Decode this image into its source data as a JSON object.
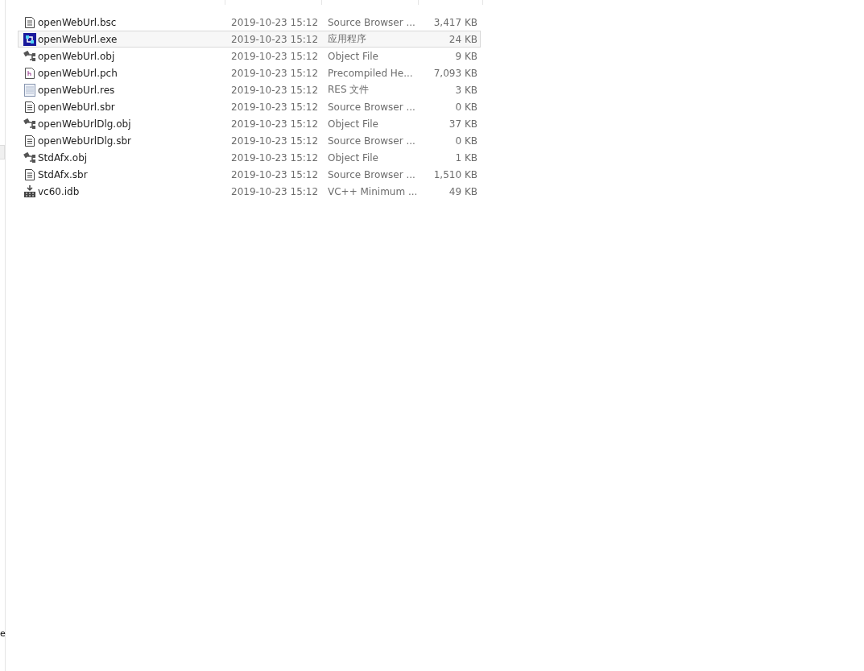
{
  "files": [
    {
      "kind": "document",
      "name": "openWebUrl.bsc",
      "date": "2019-10-23 15:12",
      "type": "Source Browser ...",
      "size": "3,417 KB",
      "selected": false
    },
    {
      "kind": "app",
      "name": "openWebUrl.exe",
      "date": "2019-10-23 15:12",
      "type": "应用程序",
      "size": "24 KB",
      "selected": true
    },
    {
      "kind": "object",
      "name": "openWebUrl.obj",
      "date": "2019-10-23 15:12",
      "type": "Object File",
      "size": "9 KB",
      "selected": false
    },
    {
      "kind": "header",
      "name": "openWebUrl.pch",
      "date": "2019-10-23 15:12",
      "type": "Precompiled He...",
      "size": "7,093 KB",
      "selected": false
    },
    {
      "kind": "notepad",
      "name": "openWebUrl.res",
      "date": "2019-10-23 15:12",
      "type": "RES 文件",
      "size": "3 KB",
      "selected": false
    },
    {
      "kind": "document",
      "name": "openWebUrl.sbr",
      "date": "2019-10-23 15:12",
      "type": "Source Browser ...",
      "size": "0 KB",
      "selected": false
    },
    {
      "kind": "object",
      "name": "openWebUrlDlg.obj",
      "date": "2019-10-23 15:12",
      "type": "Object File",
      "size": "37 KB",
      "selected": false
    },
    {
      "kind": "document",
      "name": "openWebUrlDlg.sbr",
      "date": "2019-10-23 15:12",
      "type": "Source Browser ...",
      "size": "0 KB",
      "selected": false
    },
    {
      "kind": "object",
      "name": "StdAfx.obj",
      "date": "2019-10-23 15:12",
      "type": "Object File",
      "size": "1 KB",
      "selected": false
    },
    {
      "kind": "document",
      "name": "StdAfx.sbr",
      "date": "2019-10-23 15:12",
      "type": "Source Browser ...",
      "size": "1,510 KB",
      "selected": false
    },
    {
      "kind": "database",
      "name": "vc60.idb",
      "date": "2019-10-23 15:12",
      "type": "VC++ Minimum ...",
      "size": "49 KB",
      "selected": false
    }
  ],
  "left_pane": {
    "fragment": "e"
  }
}
